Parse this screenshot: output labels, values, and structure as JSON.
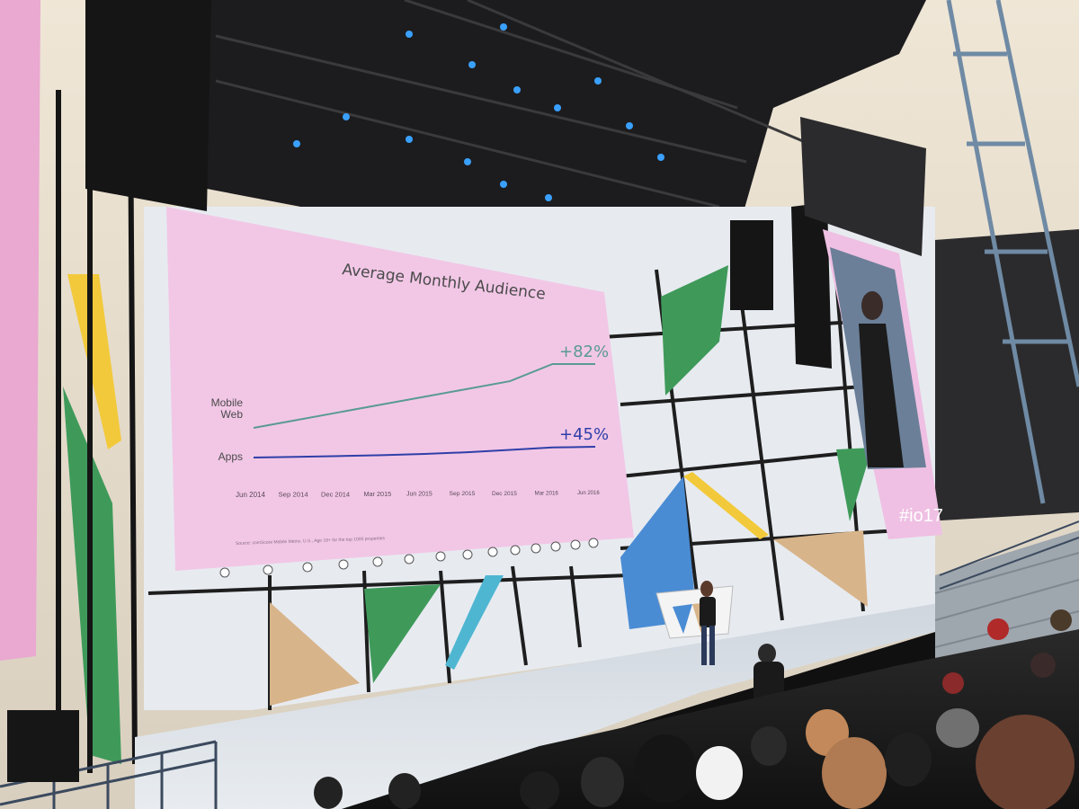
{
  "slide": {
    "title": "Average Monthly Audience",
    "source": "Source: comScore Mobile Metrix, U.S., Age 18+ for the top 1000 properties"
  },
  "chart_data": {
    "type": "line",
    "title": "Average Monthly Audience",
    "xlabel": "",
    "ylabel": "",
    "categories": [
      "Jun 2014",
      "Sep 2014",
      "Dec 2014",
      "Mar 2015",
      "Jun 2015",
      "Sep 2015",
      "Dec 2015",
      "Mar 2016",
      "Jun 2016"
    ],
    "series": [
      {
        "name": "Mobile Web",
        "end_label": "+82%",
        "color": "#5a9a94",
        "values": [
          0,
          10,
          20,
          30,
          40,
          50,
          60,
          82,
          82
        ]
      },
      {
        "name": "Apps",
        "end_label": "+45%",
        "color": "#2f3fa8",
        "values": [
          0,
          3,
          6,
          10,
          15,
          22,
          32,
          42,
          45
        ]
      }
    ],
    "ylim": [
      0,
      100
    ],
    "grid": false,
    "legend": "left-inline"
  },
  "side_screen": {
    "hashtag": "#io17"
  },
  "colors": {
    "screen_bg": "#f2c7e6",
    "stage_panel": "#e9edf2",
    "accent_green": "#3f9a5a",
    "accent_blue": "#4a8cd4",
    "accent_yellow": "#f2c93a",
    "accent_tan": "#d8b48a"
  }
}
